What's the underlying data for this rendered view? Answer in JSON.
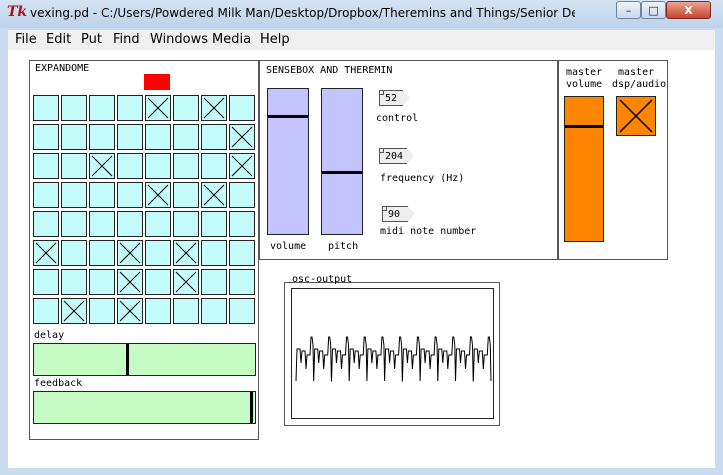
{
  "window": {
    "title": "vexing.pd  - C:/Users/Powdered Milk Man/Desktop/Dropbox/Theremins and Things/Senior Design Final Pre...",
    "app_icon": "Tk",
    "controls": {
      "minimize": "–",
      "maximize": "□",
      "close": "X"
    }
  },
  "menu": [
    "File",
    "Edit",
    "Put",
    "Find",
    "Windows",
    "Media",
    "Help"
  ],
  "expandome": {
    "title": "EXPANDOME",
    "indicator_color": "#ff0000",
    "grid_rows": [
      [
        0,
        0,
        0,
        0,
        1,
        0,
        1,
        0
      ],
      [
        0,
        0,
        0,
        0,
        0,
        0,
        0,
        1
      ],
      [
        0,
        0,
        1,
        0,
        0,
        0,
        0,
        1
      ],
      [
        0,
        0,
        0,
        0,
        1,
        0,
        1,
        0
      ],
      [
        0,
        0,
        0,
        0,
        0,
        0,
        0,
        0
      ],
      [
        1,
        0,
        0,
        1,
        0,
        1,
        0,
        0
      ],
      [
        0,
        0,
        0,
        1,
        0,
        1,
        0,
        0
      ],
      [
        0,
        1,
        0,
        1,
        0,
        0,
        0,
        0
      ]
    ],
    "delay": {
      "label": "delay",
      "value": 0.42
    },
    "feedback": {
      "label": "feedback",
      "value": 0.99
    }
  },
  "sensebox": {
    "title": "SENSEBOX AND THEREMIN",
    "volume": {
      "label": "volume",
      "value": 0.82
    },
    "pitch": {
      "label": "pitch",
      "value": 0.42
    },
    "control": {
      "value": "52",
      "label": "control"
    },
    "frequency": {
      "value": "204",
      "label": "frequency (Hz)"
    },
    "midi": {
      "value": "90",
      "label": "midi note number"
    }
  },
  "master": {
    "volume_label_1": "master",
    "volume_label_2": "volume",
    "dsp_label_1": "master",
    "dsp_label_2": "dsp/audio",
    "volume_value": 0.8,
    "dsp_on": true,
    "color": "#ff8400"
  },
  "osc": {
    "label": "osc-output"
  }
}
